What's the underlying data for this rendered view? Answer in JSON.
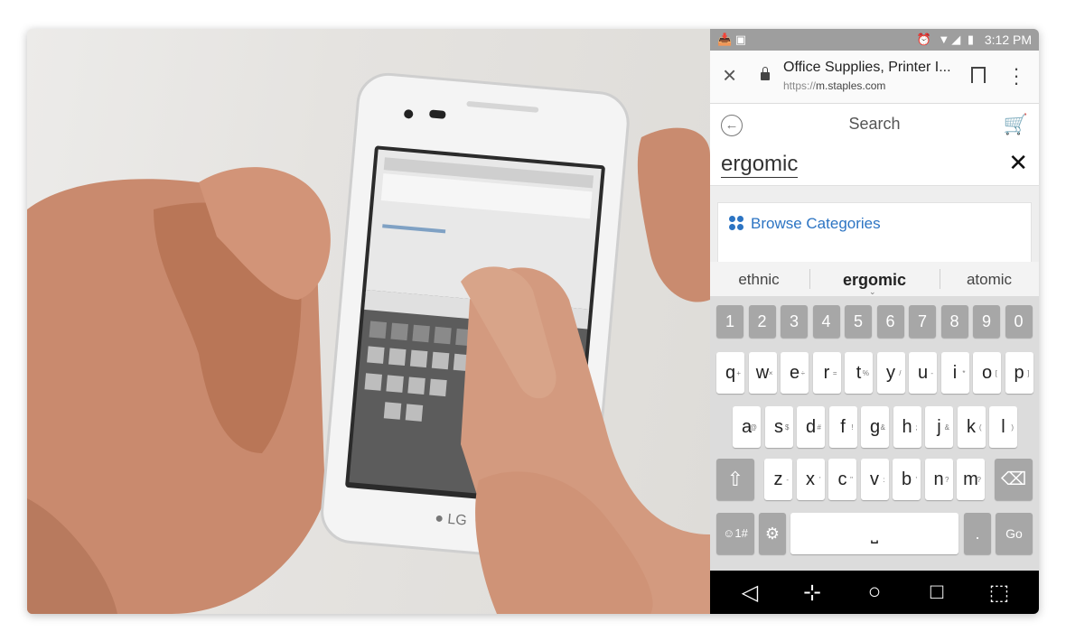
{
  "status_bar": {
    "left_icons": "📥 ▣",
    "right_icons": "⏰ ▼◢ ▮",
    "time": "3:12 PM"
  },
  "toolbar": {
    "close_icon": "×",
    "page_title": "Office Supplies, Printer I...",
    "url_prefix": "https://",
    "url_host": "m.staples.com",
    "menu_icon": "⋮"
  },
  "search": {
    "back_icon": "←",
    "title": "Search",
    "cart_icon": "🛒",
    "query": "ergomic",
    "clear_icon": "✕"
  },
  "browse": {
    "label": "Browse Categories"
  },
  "suggestions": [
    "ethnic",
    "ergomic",
    "atomic"
  ],
  "keyboard": {
    "numbers": [
      "1",
      "2",
      "3",
      "4",
      "5",
      "6",
      "7",
      "8",
      "9",
      "0"
    ],
    "row1": [
      "q",
      "w",
      "e",
      "r",
      "t",
      "y",
      "u",
      "i",
      "o",
      "p"
    ],
    "row1_sup": [
      "+",
      "×",
      "÷",
      "=",
      "%",
      "/",
      "-",
      "*",
      "[",
      "]"
    ],
    "row2": [
      "a",
      "s",
      "d",
      "f",
      "g",
      "h",
      "j",
      "k",
      "l"
    ],
    "row2_sup": [
      "@",
      "$",
      "#",
      "!",
      "&",
      ";",
      "&",
      "(",
      ")"
    ],
    "row3": [
      "z",
      "x",
      "c",
      "v",
      "b",
      "n",
      "m"
    ],
    "row3_sup": [
      "-",
      "'",
      "\"",
      ":",
      "'",
      "?",
      "?"
    ],
    "shift": "⇧",
    "backspace": "⌫",
    "emoji": "☺1#",
    "settings": "⚙",
    "space": "⎵",
    "period": ".",
    "go": "Go"
  },
  "navbar": {
    "back": "◁",
    "split": "⊹",
    "home": "○",
    "recent": "□",
    "notify": "⬚"
  },
  "colors": {
    "status_bar": "#9e9e9e",
    "link_blue": "#2c74c3",
    "key_dark": "#a7a7a7",
    "keyboard_bg": "#dcdcdc"
  }
}
